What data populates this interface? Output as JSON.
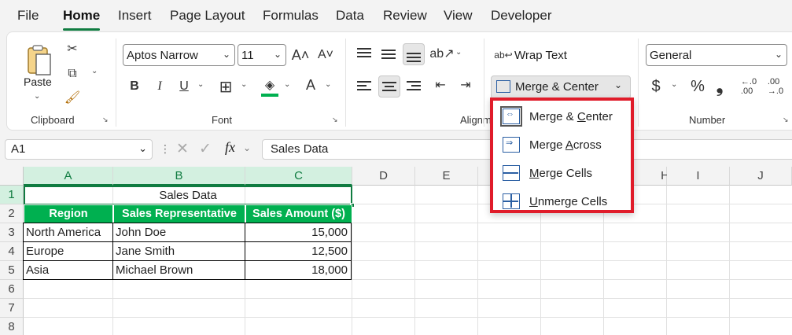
{
  "tabs": [
    "File",
    "Home",
    "Insert",
    "Page Layout",
    "Formulas",
    "Data",
    "Review",
    "View",
    "Developer"
  ],
  "active_tab": "Home",
  "clipboard": {
    "paste_label": "Paste",
    "group_label": "Clipboard"
  },
  "font": {
    "font_name": "Aptos Narrow",
    "font_size": "11",
    "group_label": "Font",
    "bold": "B",
    "italic": "I",
    "underline": "U"
  },
  "alignment": {
    "group_label": "Alignm",
    "wrap_text": "Wrap Text",
    "merge_center": "Merge & Center"
  },
  "number": {
    "format": "General",
    "group_label": "Number",
    "currency": "$",
    "percent": "%",
    "comma": "❟"
  },
  "formula_bar": {
    "name_box": "A1",
    "fx": "fx",
    "content": "Sales Data"
  },
  "columns": [
    "A",
    "B",
    "C",
    "D",
    "E",
    "F",
    "G",
    "H",
    "I",
    "J"
  ],
  "rows": [
    "1",
    "2",
    "3",
    "4",
    "5",
    "6",
    "7",
    "8"
  ],
  "sheet": {
    "title": "Sales Data",
    "headers": [
      "Region",
      "Sales Representative",
      "Sales Amount ($)"
    ],
    "data": [
      [
        "North America",
        "John Doe",
        "15,000"
      ],
      [
        "Europe",
        "Jane Smith",
        "12,500"
      ],
      [
        "Asia",
        "Michael Brown",
        "18,000"
      ]
    ]
  },
  "merge_menu": {
    "items": [
      {
        "pre": "Merge & ",
        "u": "C",
        "post": "enter"
      },
      {
        "pre": "Merge ",
        "u": "A",
        "post": "cross"
      },
      {
        "pre": "",
        "u": "M",
        "post": "erge Cells"
      },
      {
        "pre": "",
        "u": "U",
        "post": "nmerge Cells"
      }
    ]
  },
  "colors": {
    "accent": "#107c41",
    "header_fill": "#00b050",
    "highlight": "#e01c2a"
  }
}
